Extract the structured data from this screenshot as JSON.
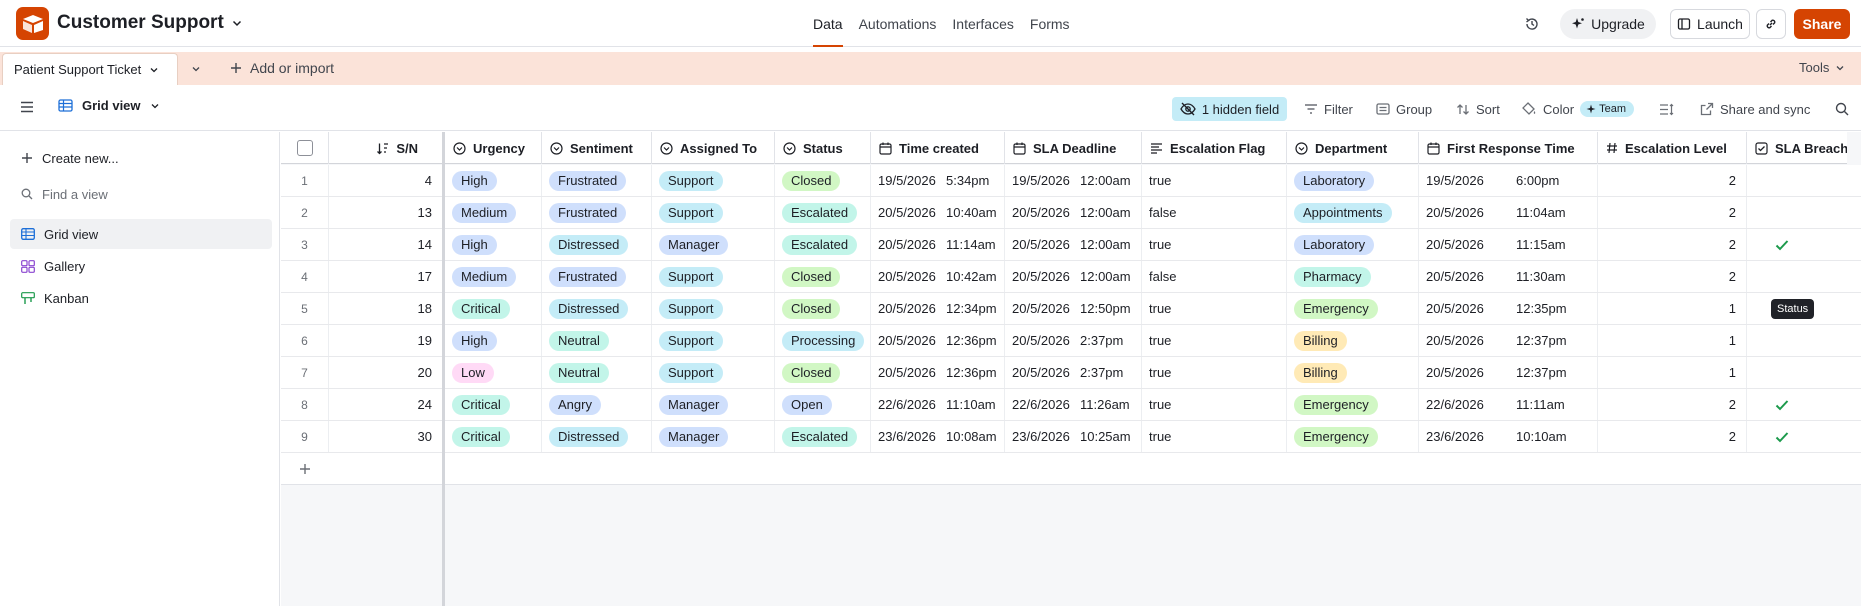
{
  "app": {
    "base_name": "Customer Support",
    "nav": [
      "Data",
      "Automations",
      "Interfaces",
      "Forms"
    ],
    "nav_active": "Data",
    "upgrade_label": "Upgrade",
    "launch_label": "Launch",
    "share_label": "Share",
    "brand_color": "#d54402"
  },
  "tabs": {
    "table_name": "Patient Support Ticket",
    "add_import_label": "Add or import",
    "tools_label": "Tools"
  },
  "viewbar": {
    "view_name": "Grid view",
    "hidden_field_label": "1 hidden field",
    "filter_label": "Filter",
    "group_label": "Group",
    "sort_label": "Sort",
    "color_label": "Color",
    "team_chip": "Team",
    "share_sync_label": "Share and sync"
  },
  "sidebar": {
    "create_new": "Create new...",
    "find_placeholder": "Find a view",
    "views": [
      {
        "label": "Grid view",
        "icon": "grid-icon"
      },
      {
        "label": "Gallery",
        "icon": "gallery-icon"
      },
      {
        "label": "Kanban",
        "icon": "kanban-icon"
      }
    ]
  },
  "grid": {
    "tooltip": "Status",
    "columns": {
      "sn": "S/N",
      "urgency": "Urgency",
      "sentiment": "Sentiment",
      "assigned": "Assigned To",
      "status": "Status",
      "time_created": "Time created",
      "sla_deadline": "SLA Deadline",
      "escalation_flag": "Escalation Flag",
      "department": "Department",
      "first_response": "First Response Time",
      "escalation_level": "Escalation Level",
      "sla_breached": "SLA Breached"
    },
    "pill_colors": {
      "High": "#cfdffc",
      "Medium": "#cfdffc",
      "Critical": "#c2f5e9",
      "Low": "#ffdaf6",
      "Frustrated": "#cfdffc",
      "Distressed": "#c4ecf7",
      "Neutral": "#c2f5e9",
      "Angry": "#cfdffc",
      "Support": "#c4ecf7",
      "Manager": "#cfdffc",
      "Closed": "#d1f7c4",
      "Escalated": "#c2f5e9",
      "Processing": "#c4ecf7",
      "Open": "#cfdffc",
      "Laboratory": "#cfdffc",
      "Appointments": "#c4ecf7",
      "Pharmacy": "#c2f5e9",
      "Emergency": "#d1f7c4",
      "Billing": "#ffeab6"
    },
    "rows": [
      {
        "idx": "1",
        "sn": "4",
        "urgency": "High",
        "sentiment": "Frustrated",
        "assigned": "Support",
        "status": "Closed",
        "tc_date": "19/5/2026",
        "tc_time": "5:34pm",
        "sla_date": "19/5/2026",
        "sla_time": "12:00am",
        "flag": "true",
        "dept": "Laboratory",
        "fr_date": "19/5/2026",
        "fr_time": "6:00pm",
        "level": "2",
        "breached": false
      },
      {
        "idx": "2",
        "sn": "13",
        "urgency": "Medium",
        "sentiment": "Frustrated",
        "assigned": "Support",
        "status": "Escalated",
        "tc_date": "20/5/2026",
        "tc_time": "10:40am",
        "sla_date": "20/5/2026",
        "sla_time": "12:00am",
        "flag": "false",
        "dept": "Appointments",
        "fr_date": "20/5/2026",
        "fr_time": "11:04am",
        "level": "2",
        "breached": false
      },
      {
        "idx": "3",
        "sn": "14",
        "urgency": "High",
        "sentiment": "Distressed",
        "assigned": "Manager",
        "status": "Escalated",
        "tc_date": "20/5/2026",
        "tc_time": "11:14am",
        "sla_date": "20/5/2026",
        "sla_time": "12:00am",
        "flag": "true",
        "dept": "Laboratory",
        "fr_date": "20/5/2026",
        "fr_time": "11:15am",
        "level": "2",
        "breached": true
      },
      {
        "idx": "4",
        "sn": "17",
        "urgency": "Medium",
        "sentiment": "Frustrated",
        "assigned": "Support",
        "status": "Closed",
        "tc_date": "20/5/2026",
        "tc_time": "10:42am",
        "sla_date": "20/5/2026",
        "sla_time": "12:00am",
        "flag": "false",
        "dept": "Pharmacy",
        "fr_date": "20/5/2026",
        "fr_time": "11:30am",
        "level": "2",
        "breached": false
      },
      {
        "idx": "5",
        "sn": "18",
        "urgency": "Critical",
        "sentiment": "Distressed",
        "assigned": "Support",
        "status": "Closed",
        "tc_date": "20/5/2026",
        "tc_time": "12:34pm",
        "sla_date": "20/5/2026",
        "sla_time": "12:50pm",
        "flag": "true",
        "dept": "Emergency",
        "fr_date": "20/5/2026",
        "fr_time": "12:35pm",
        "level": "1",
        "breached": false
      },
      {
        "idx": "6",
        "sn": "19",
        "urgency": "High",
        "sentiment": "Neutral",
        "assigned": "Support",
        "status": "Processing",
        "tc_date": "20/5/2026",
        "tc_time": "12:36pm",
        "sla_date": "20/5/2026",
        "sla_time": "2:37pm",
        "flag": "true",
        "dept": "Billing",
        "fr_date": "20/5/2026",
        "fr_time": "12:37pm",
        "level": "1",
        "breached": false
      },
      {
        "idx": "7",
        "sn": "20",
        "urgency": "Low",
        "sentiment": "Neutral",
        "assigned": "Support",
        "status": "Closed",
        "tc_date": "20/5/2026",
        "tc_time": "12:36pm",
        "sla_date": "20/5/2026",
        "sla_time": "2:37pm",
        "flag": "true",
        "dept": "Billing",
        "fr_date": "20/5/2026",
        "fr_time": "12:37pm",
        "level": "1",
        "breached": false
      },
      {
        "idx": "8",
        "sn": "24",
        "urgency": "Critical",
        "sentiment": "Angry",
        "assigned": "Manager",
        "status": "Open",
        "tc_date": "22/6/2026",
        "tc_time": "11:10am",
        "sla_date": "22/6/2026",
        "sla_time": "11:26am",
        "flag": "true",
        "dept": "Emergency",
        "fr_date": "22/6/2026",
        "fr_time": "11:11am",
        "level": "2",
        "breached": true
      },
      {
        "idx": "9",
        "sn": "30",
        "urgency": "Critical",
        "sentiment": "Distressed",
        "assigned": "Manager",
        "status": "Escalated",
        "tc_date": "23/6/2026",
        "tc_time": "10:08am",
        "sla_date": "23/6/2026",
        "sla_time": "10:25am",
        "flag": "true",
        "dept": "Emergency",
        "fr_date": "23/6/2026",
        "fr_time": "10:10am",
        "level": "2",
        "breached": true
      }
    ]
  }
}
